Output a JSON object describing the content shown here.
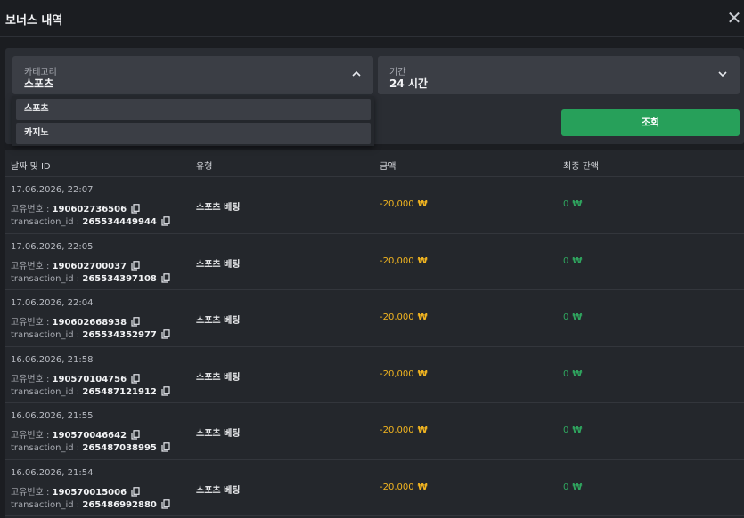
{
  "header": {
    "title": "보너스 내역",
    "close_icon": "close-icon"
  },
  "filters": {
    "category": {
      "label": "카테고리",
      "value": "스포츠",
      "expanded": true,
      "chevron": "chevron-up-icon"
    },
    "period": {
      "label": "기간",
      "value": "24 시간",
      "chevron": "chevron-down-icon"
    },
    "options": [
      "스포츠",
      "카지노"
    ],
    "search_label": "조회"
  },
  "colors": {
    "accent_green": "#27a05a",
    "amount_negative": "#f2b520",
    "balance_green": "#2fa65f"
  },
  "table": {
    "columns": [
      "날짜 및 ID",
      "유형",
      "금액",
      "최종 잔액"
    ],
    "id_label": "고유번호 :",
    "tx_label": "transaction_id :",
    "rows": [
      {
        "date": "17.06.2026, 22:07",
        "id": "190602736506",
        "transaction_id": "265534449944",
        "type": "스포츠 베팅",
        "amount": "-20,000",
        "currency": "₩",
        "balance": "0"
      },
      {
        "date": "17.06.2026, 22:05",
        "id": "190602700037",
        "transaction_id": "265534397108",
        "type": "스포츠 베팅",
        "amount": "-20,000",
        "currency": "₩",
        "balance": "0"
      },
      {
        "date": "17.06.2026, 22:04",
        "id": "190602668938",
        "transaction_id": "265534352977",
        "type": "스포츠 베팅",
        "amount": "-20,000",
        "currency": "₩",
        "balance": "0"
      },
      {
        "date": "16.06.2026, 21:58",
        "id": "190570104756",
        "transaction_id": "265487121912",
        "type": "스포츠 베팅",
        "amount": "-20,000",
        "currency": "₩",
        "balance": "0"
      },
      {
        "date": "16.06.2026, 21:55",
        "id": "190570046642",
        "transaction_id": "265487038995",
        "type": "스포츠 베팅",
        "amount": "-20,000",
        "currency": "₩",
        "balance": "0"
      },
      {
        "date": "16.06.2026, 21:54",
        "id": "190570015006",
        "transaction_id": "265486992880",
        "type": "스포츠 베팅",
        "amount": "-20,000",
        "currency": "₩",
        "balance": "0"
      }
    ]
  }
}
